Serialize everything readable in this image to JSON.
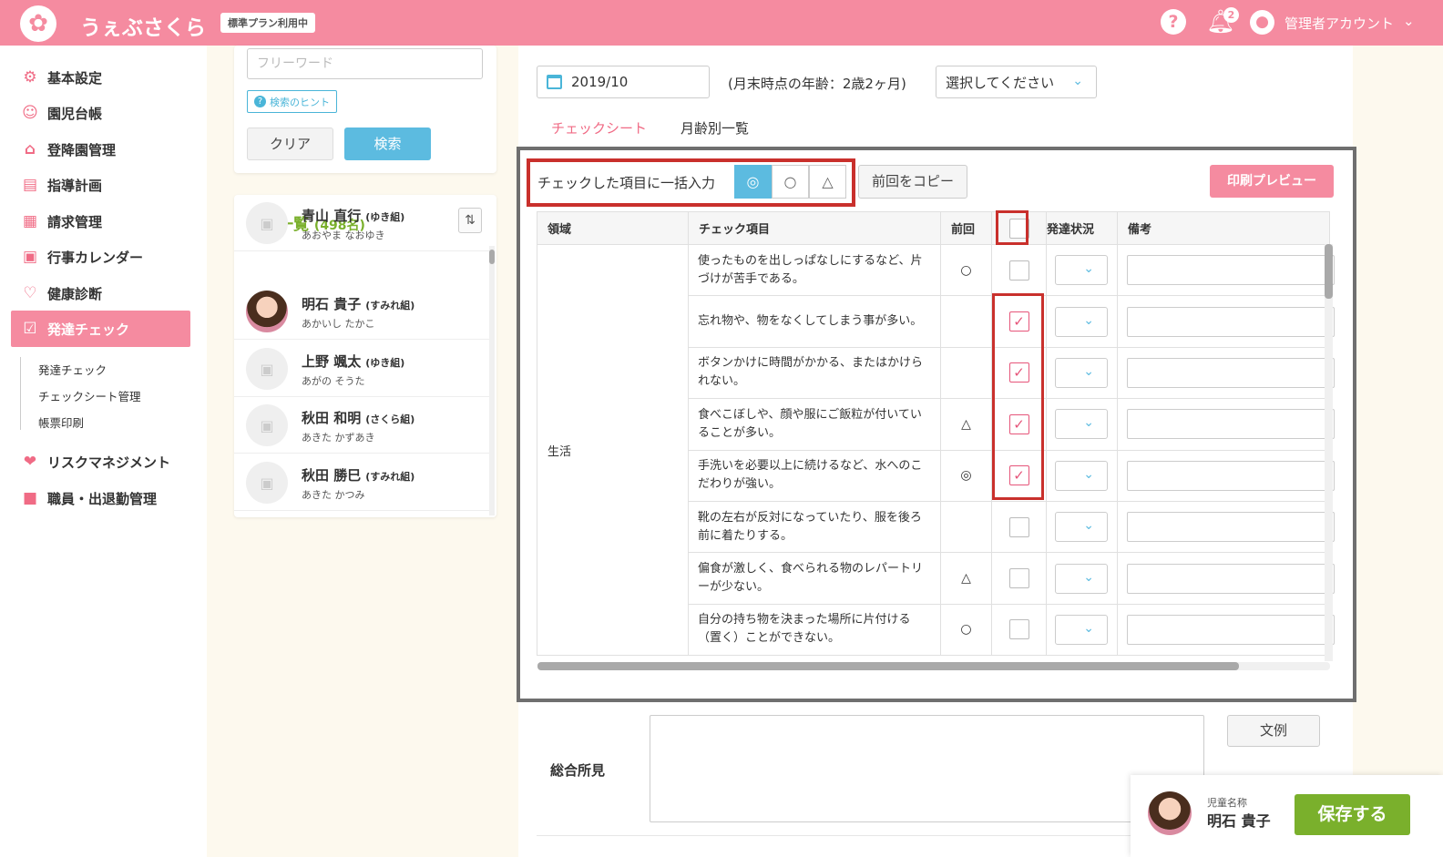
{
  "header": {
    "logo_text": "うぇぶさくら",
    "plan_badge": "標準プラン利用中",
    "help_icon": "?",
    "notification_count": "2",
    "account": "管理者アカウント"
  },
  "sidebar": {
    "items": [
      {
        "label": "基本設定",
        "icon": "gear-icon"
      },
      {
        "label": "園児台帳",
        "icon": "child-icon"
      },
      {
        "label": "登降園管理",
        "icon": "school-icon"
      },
      {
        "label": "指導計画",
        "icon": "notebook-icon"
      },
      {
        "label": "請求管理",
        "icon": "calculator-icon"
      },
      {
        "label": "行事カレンダー",
        "icon": "calendar-icon"
      },
      {
        "label": "健康診断",
        "icon": "stethoscope-icon"
      },
      {
        "label": "発達チェック",
        "icon": "checklist-icon"
      },
      {
        "label": "リスクマネジメント",
        "icon": "heart-hands-icon"
      },
      {
        "label": "職員・出退勤管理",
        "icon": "briefcase-icon"
      }
    ],
    "sub_items": [
      "発達チェック",
      "チェックシート管理",
      "帳票印刷"
    ]
  },
  "search": {
    "placeholder": "フリーワード",
    "hint_label": "検索のヒント",
    "clear_label": "クリア",
    "search_label": "検索"
  },
  "child_list": {
    "title": "園児一覧",
    "count": "(498名)",
    "children": [
      {
        "name": "青山 直行",
        "class": "(ゆき組)",
        "kana": "あおやま なおゆき"
      },
      {
        "name": "明石 貴子",
        "class": "(すみれ組)",
        "kana": "あかいし たかこ"
      },
      {
        "name": "上野 颯太",
        "class": "(ゆき組)",
        "kana": "あがの そうた"
      },
      {
        "name": "秋田 和明",
        "class": "(さくら組)",
        "kana": "あきた かずあき"
      },
      {
        "name": "秋田 勝巳",
        "class": "(すみれ組)",
        "kana": "あきた かつみ"
      }
    ]
  },
  "main": {
    "date": "2019/10",
    "age_note": "(月末時点の年齢：2歳2ヶ月)",
    "select_placeholder": "選択してください",
    "tabs": [
      "チェックシート",
      "月齢別一覧"
    ],
    "bulk_label": "チェックした項目に一括入力",
    "symbols": [
      "◎",
      "○",
      "△"
    ],
    "copy_label": "前回をコピー",
    "print_label": "印刷プレビュー",
    "table": {
      "headers": [
        "領域",
        "チェック項目",
        "前回",
        "",
        "発達状況",
        "備考"
      ],
      "area": "生活",
      "rows": [
        {
          "item": "使ったものを出しっぱなしにするなど、片づけが苦手である。",
          "prev": "○",
          "checked": false
        },
        {
          "item": "忘れ物や、物をなくしてしまう事が多い。",
          "prev": "",
          "checked": true
        },
        {
          "item": "ボタンかけに時間がかかる、またはかけられない。",
          "prev": "",
          "checked": true
        },
        {
          "item": "食べこぼしや、顔や服にご飯粒が付いていることが多い。",
          "prev": "△",
          "checked": true
        },
        {
          "item": "手洗いを必要以上に続けるなど、水へのこだわりが強い。",
          "prev": "◎",
          "checked": true
        },
        {
          "item": "靴の左右が反対になっていたり、服を後ろ前に着たりする。",
          "prev": "",
          "checked": false
        },
        {
          "item": "偏食が激しく、食べられる物のレパートリーが少ない。",
          "prev": "△",
          "checked": false
        },
        {
          "item": "自分の持ち物を決まった場所に片付ける（置く）ことができない。",
          "prev": "○",
          "checked": false
        }
      ]
    },
    "summary_label": "総合所見",
    "example_label": "文例"
  },
  "footer": {
    "child_label": "児童名称",
    "child_name": "明石 貴子",
    "save_label": "保存する"
  },
  "colors": {
    "brand_pink": "#f58ba0",
    "accent_blue": "#5cbbe0",
    "green": "#7ab02c",
    "highlight_red": "#c9302c"
  }
}
